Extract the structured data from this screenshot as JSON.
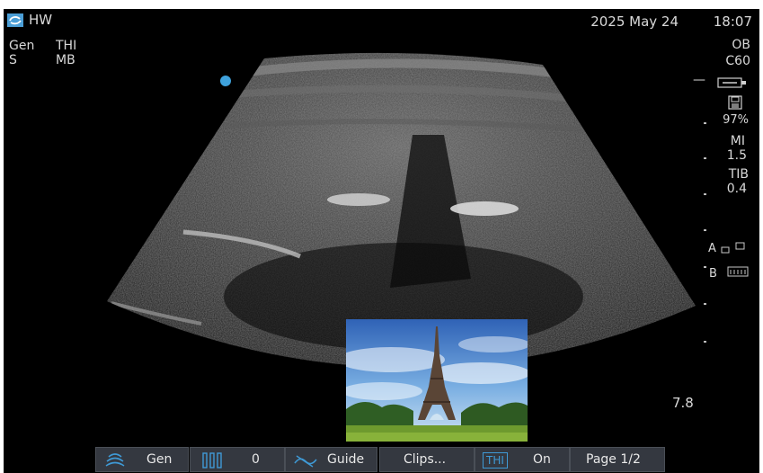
{
  "header": {
    "title": "HW",
    "date": "2025 May 24",
    "time": "18:07"
  },
  "left_info": {
    "line1_a": "Gen",
    "line1_b": "THI",
    "line2_a": "S",
    "line2_b": "MB"
  },
  "right_panel": {
    "preset": "OB",
    "probe": "C60",
    "minus": "—",
    "battery_pct": "97%",
    "mi_label": "MI",
    "mi_value": "1.5",
    "tib_label": "TIB",
    "tib_value": "0.4",
    "a_label": "A",
    "b_label": "B",
    "depth": "7.8"
  },
  "toolbar": {
    "gen_label": "Gen",
    "gain_value": "0",
    "guide_label": "Guide",
    "clips_label": "Clips...",
    "thi_badge": "THI",
    "thi_state": "On",
    "page_label": "Page 1/2"
  },
  "colors": {
    "accent": "#4a9fd8",
    "toolbar_bg": "#343840",
    "text": "#d9d9d9",
    "orientation_dot": "#3fa2dc"
  }
}
